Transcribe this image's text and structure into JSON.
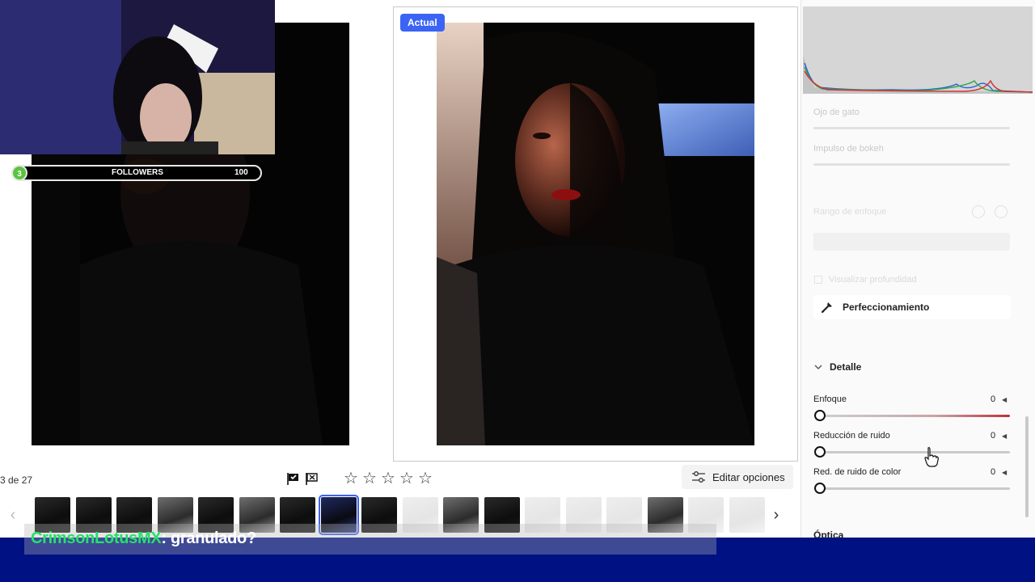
{
  "overlay": {
    "followers_label": "FOLLOWERS",
    "followers_count": "3",
    "followers_goal": "100",
    "chat_user": "CrimsonLotusMX",
    "chat_message": ": granulado?"
  },
  "compare": {
    "actual_badge": "Actual"
  },
  "toolbar": {
    "counter": "3 de 27",
    "flag_icon": "flag-check-icon",
    "reject_icon": "flag-x-icon",
    "stars": [
      "☆",
      "☆",
      "☆",
      "☆",
      "☆"
    ],
    "edit_options": "Editar opciones"
  },
  "filmstrip": {
    "prev_icon": "‹",
    "next_icon": "›",
    "thumbs": [
      "dark",
      "dark",
      "dark",
      "mid",
      "dark",
      "mid",
      "dark",
      "blue",
      "dark",
      "light",
      "mid",
      "dark",
      "light",
      "light",
      "light",
      "mid",
      "light",
      "light"
    ],
    "selected_index": 7
  },
  "panel": {
    "ojo_de_gato": "Ojo de gato",
    "impulso_bokeh": "Impulso de bokeh",
    "rango_enfoque": "Rango de enfoque",
    "visualizar_profundidad": "Visualizar profundidad",
    "perfeccionamiento": "Perfeccionamiento",
    "detalle": "Detalle",
    "optica": "Óptica",
    "sliders": [
      {
        "label": "Enfoque",
        "value": "0"
      },
      {
        "label": "Reducción de ruido",
        "value": "0"
      },
      {
        "label": "Red. de ruido de color",
        "value": "0"
      }
    ]
  },
  "colors": {
    "accent": "#3b63f5",
    "chat_user": "#27e06b",
    "stream_bar": "#001184"
  }
}
